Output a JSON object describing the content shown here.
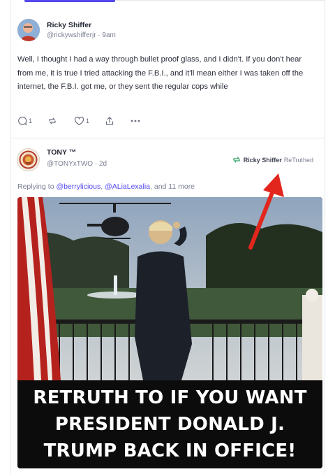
{
  "post1": {
    "author_name": "Ricky Shiffer",
    "handle_time": "@rickywshifferjr · 9am",
    "body": "Well, I thought I had a way through bullet proof glass, and I didn't.  If you don't hear from me, it is true I tried attacking the F.B.I., and it'll mean either I was taken off the internet, the F.B.I. got me, or they sent the regular cops while",
    "actions": {
      "reply_count": "1",
      "retruth_count": "",
      "like_count": "1"
    }
  },
  "post2": {
    "author_name": "TONY ™",
    "handle_time": "@TONYxTWO · 2d",
    "retruth_user": "Ricky Shiffer",
    "retruth_label": "ReTruthed",
    "replying_prefix": "Replying to",
    "replying_user1": "@berrylicious",
    "replying_sep": ",",
    "replying_user2": "@ALiaLexalia",
    "replying_more": ", and 11 more",
    "image_banner": {
      "line1": "RETRUTH TO IF YOU WANT",
      "line2": "PRESIDENT DONALD J.",
      "line3": "TRUMP BACK IN OFFICE!"
    }
  },
  "colors": {
    "accent": "#5448ee",
    "retruth_green": "#2e9e62",
    "arrow_red": "#e2261d"
  }
}
